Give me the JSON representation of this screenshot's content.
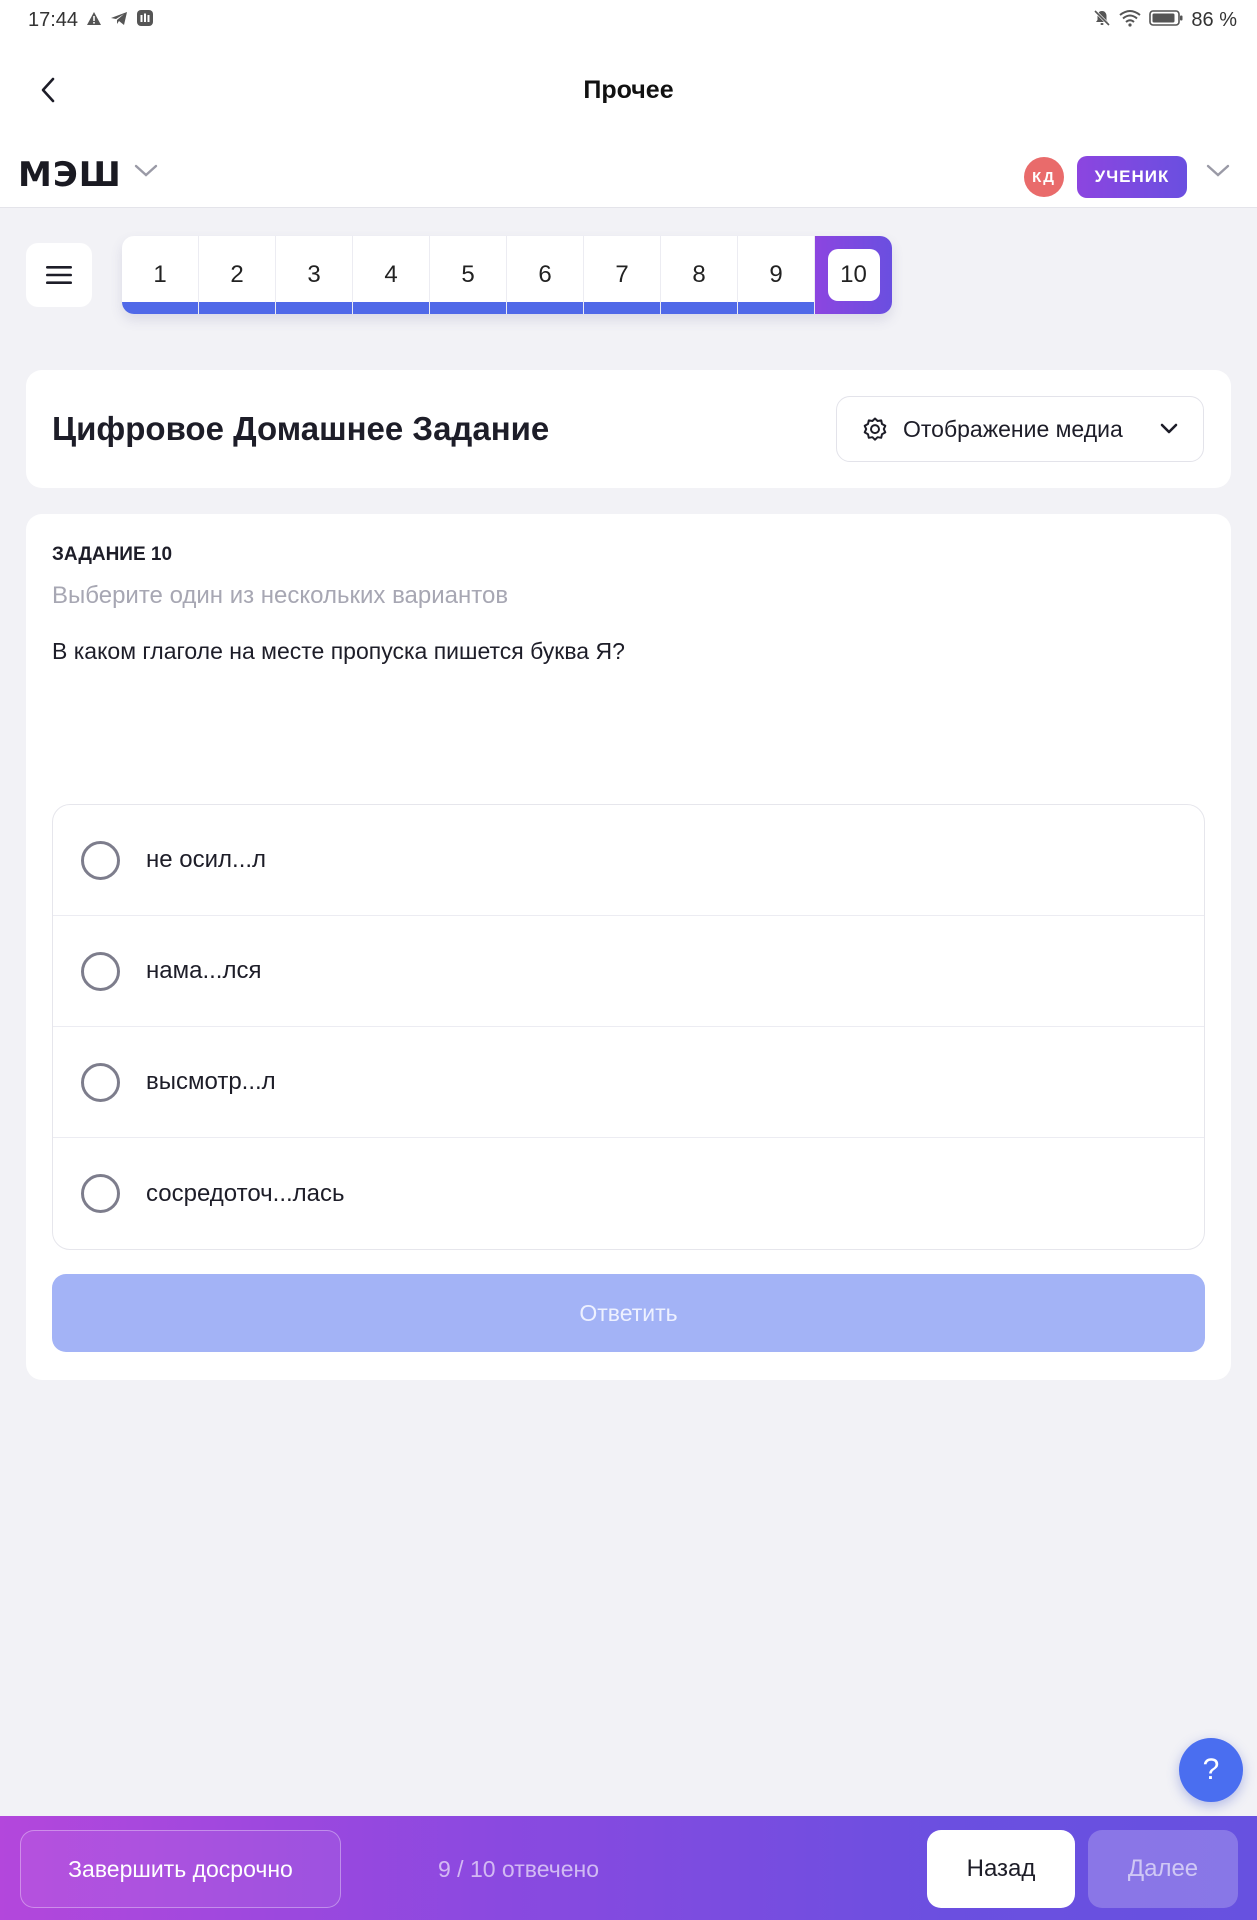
{
  "status_bar": {
    "time": "17:44",
    "battery": "86 %",
    "left_icons": [
      "warning-icon",
      "telegram-icon",
      "app-icon"
    ],
    "right_icons": [
      "bell-off-icon",
      "wifi-icon",
      "battery-icon"
    ]
  },
  "topbar": {
    "title": "Прочее",
    "back_icon": "chevron-left-icon"
  },
  "brand": {
    "logo": "МЭШ",
    "user_initials": "КД",
    "role": "УЧЕНИК",
    "accent_color": "#7a4ae0",
    "avatar_color": "#e96b6b"
  },
  "question_nav": {
    "items": [
      {
        "label": "1",
        "answered": true
      },
      {
        "label": "2",
        "answered": true
      },
      {
        "label": "3",
        "answered": true
      },
      {
        "label": "4",
        "answered": true
      },
      {
        "label": "5",
        "answered": true
      },
      {
        "label": "6",
        "answered": true
      },
      {
        "label": "7",
        "answered": true
      },
      {
        "label": "8",
        "answered": true
      },
      {
        "label": "9",
        "answered": true
      },
      {
        "label": "10",
        "answered": false
      }
    ],
    "active": "10"
  },
  "header": {
    "title": "Цифровое Домашнее Задание",
    "media_button": "Отображение медиа"
  },
  "task": {
    "number_label": "ЗАДАНИЕ 10",
    "hint": "Выберите один из нескольких вариантов",
    "question": "В каком глаголе на месте пропуска пишется буква Я?",
    "options": [
      {
        "label": "не осил...л",
        "selected": false
      },
      {
        "label": "нама...лся",
        "selected": false
      },
      {
        "label": "высмотр...л",
        "selected": false
      },
      {
        "label": "сосредоточ...лась",
        "selected": false
      }
    ],
    "answer_button": "Ответить"
  },
  "help": {
    "label": "?"
  },
  "footer": {
    "finish_button": "Завершить досрочно",
    "progress": "9 / 10 отвечено",
    "back_button": "Назад",
    "next_button": "Далее"
  }
}
